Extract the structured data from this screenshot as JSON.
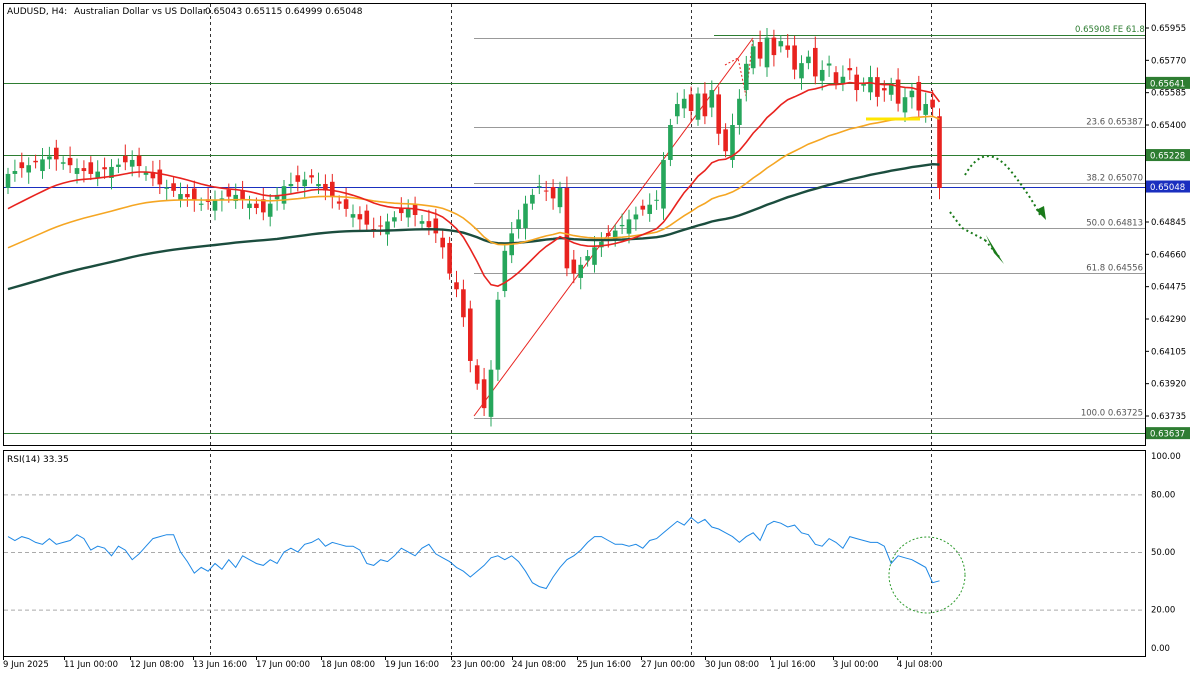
{
  "header": {
    "symbol_tf": "AUDUSD, H4:",
    "description": "Australian Dollar vs US Dollar",
    "ohlc": "0.65043 0.65115 0.64999 0.65048"
  },
  "chart_data": [
    {
      "type": "candlestick",
      "ylim": [
        0.6354,
        0.6604
      ],
      "price_ticks": [
        "0.65955",
        "0.65770",
        "0.65585",
        "0.65400",
        "0.65215",
        "0.65030",
        "0.64845",
        "0.64660",
        "0.64475",
        "0.64290",
        "0.64105",
        "0.63920",
        "0.63735"
      ],
      "x_labels": [
        "9 Jun 2025",
        "11 Jun 00:00",
        "12 Jun 08:00",
        "13 Jun 16:00",
        "17 Jun 00:00",
        "18 Jun 08:00",
        "19 Jun 16:00",
        "23 Jun 00:00",
        "24 Jun 08:00",
        "25 Jun 16:00",
        "27 Jun 00:00",
        "30 Jun 08:00",
        "1 Jul 16:00",
        "3 Jul 00:00",
        "4 Jul 08:00"
      ],
      "candles_count": 136,
      "colors": {
        "up": "#26a65b",
        "down": "#e8231f",
        "ema_fast": "#e8231f",
        "ema_mid": "#f5a623",
        "ema_slow": "#1b4d3e",
        "bid_line": "#1a2fbf",
        "level": "#2e7d32"
      },
      "levels": [
        {
          "price": 0.65641,
          "label": "0.65641"
        },
        {
          "price": 0.65228,
          "label": "0.65228"
        },
        {
          "price": 0.63637,
          "label": "0.63637"
        }
      ],
      "bid": {
        "price": 0.65048,
        "label": "0.65048"
      },
      "fibonacci": {
        "top_label": "0.65908 FE 61.8",
        "levels": [
          {
            "price": 0.65387,
            "label": "23.6 0.65387"
          },
          {
            "price": 0.6507,
            "label": "38.2 0.65070"
          },
          {
            "price": 0.64813,
            "label": "50.0 0.64813"
          },
          {
            "price": 0.64556,
            "label": "61.8 0.64556"
          },
          {
            "price": 0.63725,
            "label": "100.0 0.63725"
          }
        ]
      }
    },
    {
      "type": "line",
      "label": "RSI(14) 33.35",
      "ylim": [
        0,
        100
      ],
      "y_ticks": [
        "100.00",
        "80.00",
        "50.00",
        "20.00",
        "0.00"
      ],
      "levels": [
        80,
        50,
        20
      ],
      "color": "#1e88e5",
      "values": [
        58,
        56,
        58,
        57,
        55,
        54,
        57,
        54,
        55,
        56,
        59,
        57,
        51,
        53,
        52,
        48,
        53,
        51,
        46,
        49,
        53,
        57,
        58,
        59,
        59,
        50,
        45,
        39,
        42,
        40,
        44,
        41,
        46,
        42,
        48,
        46,
        44,
        43,
        46,
        44,
        50,
        52,
        50,
        54,
        55,
        57,
        53,
        55,
        54,
        53,
        53,
        51,
        44,
        43,
        46,
        45,
        48,
        52,
        50,
        48,
        52,
        54,
        49,
        47,
        45,
        42,
        40,
        37,
        40,
        43,
        47,
        48,
        46,
        48,
        45,
        40,
        34,
        32,
        31,
        37,
        42,
        46,
        48,
        51,
        55,
        58,
        58,
        56,
        54,
        54,
        53,
        54,
        52,
        56,
        57,
        60,
        63,
        66,
        64,
        68,
        65,
        67,
        63,
        62,
        60,
        58,
        55,
        58,
        60,
        56,
        64,
        66,
        65,
        63,
        64,
        60,
        59,
        54,
        53,
        57,
        55,
        52,
        58,
        57,
        56,
        55,
        55,
        53,
        44,
        48,
        47,
        46,
        44,
        42,
        34,
        35
      ]
    }
  ],
  "axis_badges": {
    "level_1": "0.65641",
    "level_2": "0.65228",
    "bid": "0.65048",
    "level_3": "0.63637"
  }
}
